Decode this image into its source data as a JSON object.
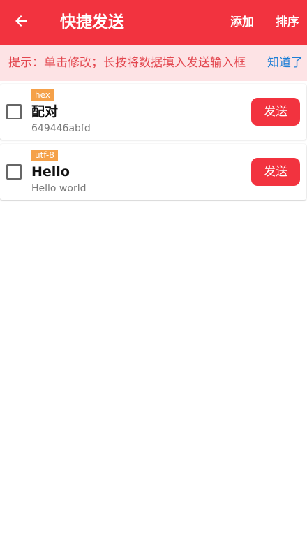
{
  "appbar": {
    "title": "快捷发送",
    "add_label": "添加",
    "sort_label": "排序",
    "back_icon": "arrow-left-icon",
    "background": "#f2333f"
  },
  "hint": {
    "text": "提示：单击修改；长按将数据填入发送输入框",
    "dismiss_label": "知道了",
    "background": "#fde3e5",
    "text_color": "#e3474f",
    "link_color": "#1e7fd6"
  },
  "items": [
    {
      "encoding": "hex",
      "name": "配对",
      "data": "649446abfd",
      "checked": false,
      "send_label": "发送"
    },
    {
      "encoding": "utf-8",
      "name": "Hello",
      "data": "Hello world",
      "checked": false,
      "send_label": "发送"
    }
  ],
  "colors": {
    "accent": "#f2333f",
    "tag": "#f5a149"
  }
}
